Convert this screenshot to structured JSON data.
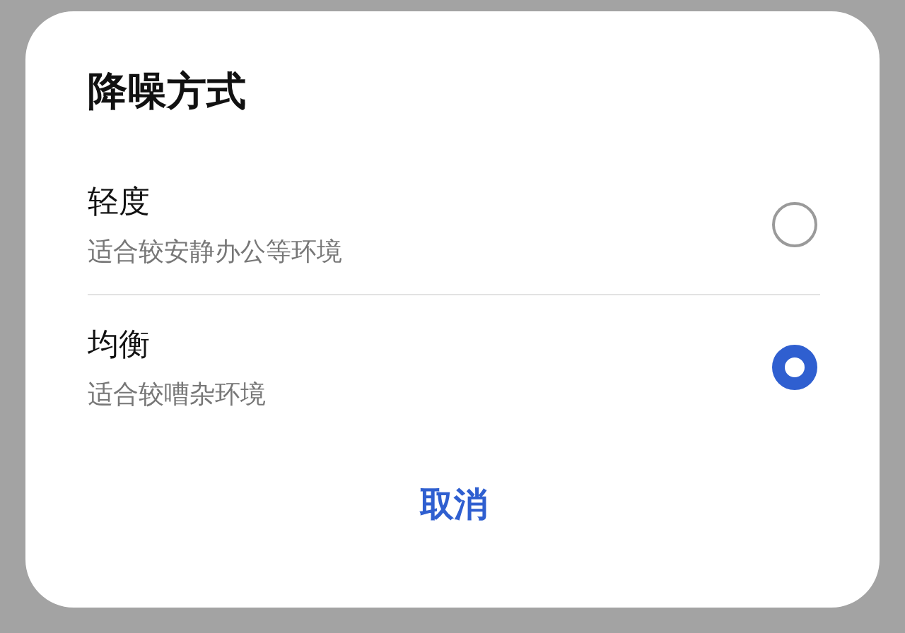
{
  "dialog": {
    "title": "降噪方式",
    "options": [
      {
        "label": "轻度",
        "description": "适合较安静办公等环境",
        "selected": false
      },
      {
        "label": "均衡",
        "description": "适合较嘈杂环境",
        "selected": true
      }
    ],
    "cancel": "取消"
  }
}
